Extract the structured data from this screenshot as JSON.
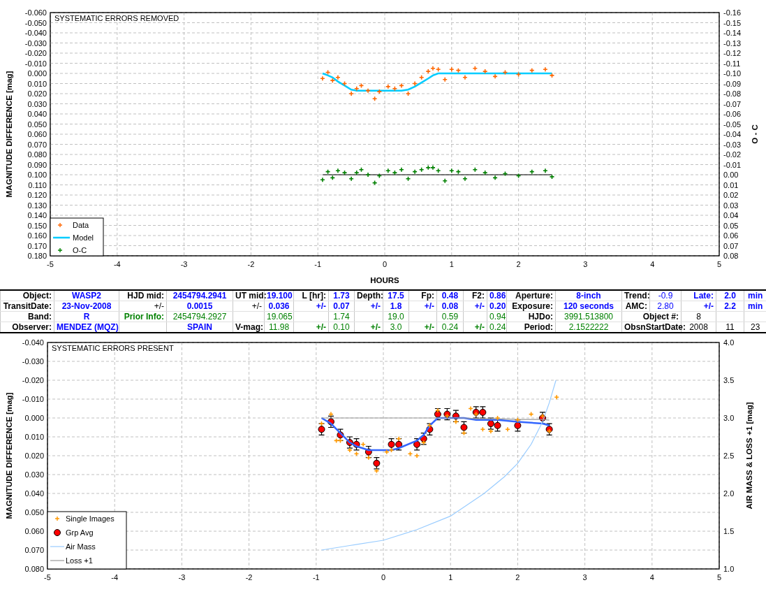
{
  "top_chart": {
    "chart_data": {
      "type": "scatter",
      "title": "SYSTEMATIC ERRORS REMOVED",
      "xlabel": "HOURS",
      "ylabel": "MAGNITUDE DIFFERENCE [mag]",
      "y2label": "O - C",
      "grid": true,
      "legend": "lower left",
      "xlim": [
        -5,
        5
      ],
      "ylim": [
        0.18,
        -0.06
      ],
      "y2lim": [
        0.08,
        -0.16
      ],
      "xticks": [
        {
          "value": -5,
          "label": "-5"
        },
        {
          "value": -4,
          "label": "-4"
        },
        {
          "value": -3,
          "label": "-3"
        },
        {
          "value": -2,
          "label": "-2"
        },
        {
          "value": -1,
          "label": "-1"
        },
        {
          "value": 0,
          "label": "0"
        },
        {
          "value": 1,
          "label": "1"
        },
        {
          "value": 2,
          "label": "2"
        },
        {
          "value": 3,
          "label": "3"
        },
        {
          "value": 4,
          "label": "4"
        },
        {
          "value": 5,
          "label": "5"
        }
      ],
      "yticks": [
        {
          "value": -0.06,
          "label": "-0.060"
        },
        {
          "value": -0.05,
          "label": "-0.050"
        },
        {
          "value": -0.04,
          "label": "-0.040"
        },
        {
          "value": -0.03,
          "label": "-0.030"
        },
        {
          "value": -0.02,
          "label": "-0.020"
        },
        {
          "value": -0.01,
          "label": "-0.010"
        },
        {
          "value": 0,
          "label": "0.000"
        },
        {
          "value": 0.01,
          "label": "0.010"
        },
        {
          "value": 0.02,
          "label": "0.020"
        },
        {
          "value": 0.03,
          "label": "0.030"
        },
        {
          "value": 0.04,
          "label": "0.040"
        },
        {
          "value": 0.05,
          "label": "0.050"
        },
        {
          "value": 0.06,
          "label": "0.060"
        },
        {
          "value": 0.07,
          "label": "0.070"
        },
        {
          "value": 0.08,
          "label": "0.080"
        },
        {
          "value": 0.09,
          "label": "0.090"
        },
        {
          "value": 0.1,
          "label": "0.100"
        },
        {
          "value": 0.11,
          "label": "0.110"
        },
        {
          "value": 0.12,
          "label": "0.120"
        },
        {
          "value": 0.13,
          "label": "0.130"
        },
        {
          "value": 0.14,
          "label": "0.140"
        },
        {
          "value": 0.15,
          "label": "0.150"
        },
        {
          "value": 0.16,
          "label": "0.160"
        },
        {
          "value": 0.17,
          "label": "0.170"
        },
        {
          "value": 0.18,
          "label": "0.180"
        }
      ],
      "y2ticks": [
        {
          "value": -0.16,
          "label": "-0.16"
        },
        {
          "value": -0.15,
          "label": "-0.15"
        },
        {
          "value": -0.14,
          "label": "-0.14"
        },
        {
          "value": -0.13,
          "label": "-0.13"
        },
        {
          "value": -0.12,
          "label": "-0.12"
        },
        {
          "value": -0.11,
          "label": "-0.11"
        },
        {
          "value": -0.1,
          "label": "-0.10"
        },
        {
          "value": -0.09,
          "label": "-0.09"
        },
        {
          "value": -0.08,
          "label": "-0.08"
        },
        {
          "value": -0.07,
          "label": "-0.07"
        },
        {
          "value": -0.06,
          "label": "-0.06"
        },
        {
          "value": -0.05,
          "label": "-0.05"
        },
        {
          "value": -0.04,
          "label": "-0.04"
        },
        {
          "value": -0.03,
          "label": "-0.03"
        },
        {
          "value": -0.02,
          "label": "-0.02"
        },
        {
          "value": -0.01,
          "label": "-0.01"
        },
        {
          "value": 0,
          "label": "0.00"
        },
        {
          "value": 0.01,
          "label": "0.01"
        },
        {
          "value": 0.02,
          "label": "0.02"
        },
        {
          "value": 0.03,
          "label": "0.03"
        },
        {
          "value": 0.04,
          "label": "0.04"
        },
        {
          "value": 0.05,
          "label": "0.05"
        },
        {
          "value": 0.06,
          "label": "0.06"
        },
        {
          "value": 0.07,
          "label": "0.07"
        },
        {
          "value": 0.08,
          "label": "0.08"
        }
      ],
      "x": [
        -0.93,
        -0.85,
        -0.78,
        -0.7,
        -0.6,
        -0.5,
        -0.42,
        -0.35,
        -0.25,
        -0.15,
        -0.08,
        0.05,
        0.15,
        0.25,
        0.35,
        0.45,
        0.55,
        0.65,
        0.72,
        0.8,
        0.9,
        1.0,
        1.1,
        1.2,
        1.35,
        1.5,
        1.65,
        1.8,
        2.0,
        2.2,
        2.4,
        2.5
      ],
      "series": [
        {
          "name": "Data",
          "type": "scatter",
          "marker": "plus",
          "color": "#ff6600",
          "values": [
            0.005,
            -0.001,
            0.007,
            0.004,
            0.01,
            0.02,
            0.015,
            0.012,
            0.017,
            0.025,
            0.018,
            0.013,
            0.015,
            0.012,
            0.02,
            0.01,
            0.004,
            -0.002,
            -0.005,
            -0.004,
            0.006,
            -0.004,
            -0.003,
            0.004,
            -0.005,
            -0.002,
            0.003,
            -0.001,
            0.001,
            -0.003,
            -0.004,
            0.002
          ]
        },
        {
          "name": "Model",
          "type": "line",
          "color": "#00ccff",
          "values": [
            0,
            0.002,
            0.004,
            0.008,
            0.012,
            0.016,
            0.017,
            0.017,
            0.017,
            0.017,
            0.017,
            0.017,
            0.017,
            0.017,
            0.016,
            0.013,
            0.009,
            0.005,
            0.002,
            0,
            0,
            0,
            0,
            0,
            0,
            0,
            0,
            0,
            0,
            0,
            0,
            0
          ]
        },
        {
          "name": "O-C",
          "type": "scatter",
          "marker": "plus",
          "color": "#008000",
          "axis": "y2",
          "values": [
            0.005,
            -0.003,
            0.003,
            -0.004,
            -0.002,
            0.004,
            -0.002,
            -0.005,
            0,
            0.008,
            0.001,
            -0.004,
            -0.002,
            -0.005,
            0.004,
            -0.003,
            -0.005,
            -0.007,
            -0.007,
            -0.004,
            0.006,
            -0.004,
            -0.003,
            0.004,
            -0.005,
            -0.002,
            0.003,
            -0.001,
            0.001,
            -0.003,
            -0.004,
            0.002
          ]
        },
        {
          "type": "line",
          "color": "#000000",
          "axis": "y2",
          "values": [
            0,
            0,
            0,
            0,
            0,
            0,
            0,
            0,
            0,
            0,
            0,
            0,
            0,
            0,
            0,
            0,
            0,
            0,
            0,
            0,
            0,
            0,
            0,
            0,
            0,
            0,
            0,
            0,
            0,
            0,
            0,
            0
          ]
        }
      ]
    }
  },
  "parameters_table": {
    "rows": [
      [
        {
          "text": "Object:",
          "kind": "label"
        },
        {
          "text": "WASP2",
          "kind": "blue"
        },
        {
          "text": "HJD mid:",
          "kind": "label"
        },
        {
          "text": "2454794.2941",
          "kind": "blue"
        },
        {
          "text": "UT mid:",
          "kind": "label"
        },
        {
          "text": "19.100",
          "kind": "blue"
        },
        {
          "text": "L [hr]:",
          "kind": "label"
        },
        {
          "text": "1.73",
          "kind": "blue"
        },
        {
          "text": "Depth:",
          "kind": "label"
        },
        {
          "text": "17.5",
          "kind": "blue"
        },
        {
          "text": "Fp:",
          "kind": "label"
        },
        {
          "text": "0.48",
          "kind": "blue"
        },
        {
          "text": "F2:",
          "kind": "label"
        },
        {
          "text": "0.86",
          "kind": "blue"
        },
        {
          "text": "Aperture:",
          "kind": "label"
        },
        {
          "text": "8-inch",
          "kind": "blue"
        },
        {
          "text": "Trend:",
          "kind": "label"
        },
        {
          "text": "-0.9",
          "kind": "blueplain"
        },
        {
          "text": "Late:",
          "kind": "bluelabel"
        },
        {
          "text": "2.0",
          "kind": "blue"
        },
        {
          "text": "min",
          "kind": "blue"
        }
      ],
      [
        {
          "text": "TransitDate:",
          "kind": "label"
        },
        {
          "text": "23-Nov-2008",
          "kind": "blue"
        },
        {
          "text": "+/-",
          "kind": "plainlabel"
        },
        {
          "text": "0.0015",
          "kind": "blue"
        },
        {
          "text": "+/-",
          "kind": "plainlabel"
        },
        {
          "text": "0.036",
          "kind": "blue"
        },
        {
          "text": "+/-",
          "kind": "bluelabel"
        },
        {
          "text": "0.07",
          "kind": "blue"
        },
        {
          "text": "+/-",
          "kind": "bluelabel"
        },
        {
          "text": "1.8",
          "kind": "blue"
        },
        {
          "text": "+/-",
          "kind": "bluelabel"
        },
        {
          "text": "0.08",
          "kind": "blue"
        },
        {
          "text": "+/-",
          "kind": "bluelabel"
        },
        {
          "text": "0.20",
          "kind": "blue"
        },
        {
          "text": "Exposure:",
          "kind": "label"
        },
        {
          "text": "120 seconds",
          "kind": "blue"
        },
        {
          "text": "AMC:",
          "kind": "label"
        },
        {
          "text": "2.80",
          "kind": "blueplain"
        },
        {
          "text": "+/-",
          "kind": "bluelabel"
        },
        {
          "text": "2.2",
          "kind": "blue"
        },
        {
          "text": "min",
          "kind": "blue"
        }
      ],
      [
        {
          "text": "Band:",
          "kind": "label"
        },
        {
          "text": "R",
          "kind": "blue"
        },
        {
          "text": "Prior Info:",
          "kind": "greenlabel"
        },
        {
          "text": "2454794.2927",
          "kind": "green"
        },
        null,
        {
          "text": "19.065",
          "kind": "green"
        },
        null,
        {
          "text": "1.74",
          "kind": "green"
        },
        null,
        {
          "text": "19.0",
          "kind": "green"
        },
        null,
        {
          "text": "0.59",
          "kind": "green"
        },
        null,
        {
          "text": "0.94",
          "kind": "green"
        },
        {
          "text": "HJDo:",
          "kind": "label"
        },
        {
          "text": "3991.513800",
          "kind": "green"
        },
        {
          "text": "Object #:",
          "kind": "label",
          "colspan": 2
        },
        {
          "text": "8",
          "kind": "plain"
        },
        null,
        null
      ],
      [
        {
          "text": "Observer:",
          "kind": "label"
        },
        {
          "text": "MENDEZ (MQZ)",
          "kind": "blue"
        },
        null,
        {
          "text": "SPAIN",
          "kind": "blue"
        },
        {
          "text": "V-mag:",
          "kind": "label"
        },
        {
          "text": "11.98",
          "kind": "green"
        },
        {
          "text": "+/-",
          "kind": "greenlabel"
        },
        {
          "text": "0.10",
          "kind": "green"
        },
        {
          "text": "+/-",
          "kind": "greenlabel"
        },
        {
          "text": "3.0",
          "kind": "green"
        },
        {
          "text": "+/-",
          "kind": "greenlabel"
        },
        {
          "text": "0.24",
          "kind": "green"
        },
        {
          "text": "+/-",
          "kind": "greenlabel"
        },
        {
          "text": "0.24",
          "kind": "green"
        },
        {
          "text": "Period:",
          "kind": "label"
        },
        {
          "text": "2.1522222",
          "kind": "green"
        },
        {
          "text": "ObsnStartDate:",
          "kind": "label",
          "colspan": 2
        },
        {
          "text": "2008",
          "kind": "plain"
        },
        {
          "text": "11",
          "kind": "plain"
        },
        {
          "text": "23",
          "kind": "plain"
        }
      ]
    ]
  },
  "bottom_chart": {
    "chart_data": {
      "type": "scatter",
      "title": "SYSTEMATIC ERRORS PRESENT",
      "ylabel": "MAGNITUDE DIFFERENCE [mag]",
      "y2label": "AIR MASS & LOSS +1 [mag]",
      "grid": true,
      "legend": "lower left",
      "xlim": [
        -5,
        5
      ],
      "ylim": [
        0.08,
        -0.04
      ],
      "y2lim": [
        1,
        4
      ],
      "xticks": [
        {
          "value": -5,
          "label": "-5"
        },
        {
          "value": -4,
          "label": "-4"
        },
        {
          "value": -3,
          "label": "-3"
        },
        {
          "value": -2,
          "label": "-2"
        },
        {
          "value": -1,
          "label": "-1"
        },
        {
          "value": 0,
          "label": "0"
        },
        {
          "value": 1,
          "label": "1"
        },
        {
          "value": 2,
          "label": "2"
        },
        {
          "value": 3,
          "label": "3"
        },
        {
          "value": 4,
          "label": "4"
        },
        {
          "value": 5,
          "label": "5"
        }
      ],
      "yticks": [
        {
          "value": -0.04,
          "label": "-0.040"
        },
        {
          "value": -0.03,
          "label": "-0.030"
        },
        {
          "value": -0.02,
          "label": "-0.020"
        },
        {
          "value": -0.01,
          "label": "-0.010"
        },
        {
          "value": 0,
          "label": "0.000"
        },
        {
          "value": 0.01,
          "label": "0.010"
        },
        {
          "value": 0.02,
          "label": "0.020"
        },
        {
          "value": 0.03,
          "label": "0.030"
        },
        {
          "value": 0.04,
          "label": "0.040"
        },
        {
          "value": 0.05,
          "label": "0.050"
        },
        {
          "value": 0.06,
          "label": "0.060"
        },
        {
          "value": 0.07,
          "label": "0.070"
        },
        {
          "value": 0.08,
          "label": "0.080"
        }
      ],
      "y2ticks": [
        {
          "value": 1,
          "label": "1.0"
        },
        {
          "value": 1.5,
          "label": "1.5"
        },
        {
          "value": 2,
          "label": "2.0"
        },
        {
          "value": 2.5,
          "label": "2.5"
        },
        {
          "value": 3,
          "label": "3.0"
        },
        {
          "value": 3.5,
          "label": "3.5"
        },
        {
          "value": 4,
          "label": "4.0"
        }
      ],
      "x": [
        -0.92,
        -0.78,
        -0.64,
        -0.5,
        -0.4,
        -0.22,
        -0.1,
        0.12,
        0.23,
        0.5,
        0.6,
        0.69,
        0.81,
        0.95,
        1.08,
        1.2,
        1.38,
        1.48,
        1.6,
        1.7,
        2.0,
        2.37,
        2.47
      ],
      "series": [
        {
          "name": "Single Images",
          "type": "scatter",
          "marker": "plus",
          "color": "#ff9900",
          "x": [
            -0.92,
            -0.78,
            -0.7,
            -0.64,
            -0.5,
            -0.4,
            -0.3,
            -0.22,
            -0.1,
            0.05,
            0.12,
            0.23,
            0.4,
            0.5,
            0.6,
            0.69,
            0.81,
            0.95,
            1.08,
            1.2,
            1.3,
            1.38,
            1.48,
            1.6,
            1.7,
            1.85,
            2.0,
            2.2,
            2.37,
            2.47,
            2.58
          ],
          "values": [
            0.003,
            -0.002,
            0.012,
            0.012,
            0.017,
            0.019,
            0.014,
            0.021,
            0.028,
            0.018,
            0.017,
            0.011,
            0.019,
            0.02,
            0.013,
            0.004,
            -0.004,
            -0.001,
            0.002,
            0.008,
            -0.005,
            -0.002,
            0.006,
            0.007,
            0.0,
            0.006,
            0.001,
            -0.002,
            -0.001,
            0.007,
            -0.011
          ]
        },
        {
          "name": "Grp Avg",
          "type": "scatter",
          "marker": "circle",
          "color": "#ff0000",
          "errors": [
            0.003,
            0.003,
            0.003,
            0.003,
            0.003,
            0.003,
            0.003,
            0.003,
            0.003,
            0.003,
            0.003,
            0.003,
            0.003,
            0.003,
            0.003,
            0.003,
            0.003,
            0.003,
            0.003,
            0.003,
            0.003,
            0.003,
            0.003
          ],
          "values": [
            0.006,
            0.002,
            0.009,
            0.013,
            0.014,
            0.018,
            0.024,
            0.014,
            0.014,
            0.014,
            0.011,
            0.006,
            -0.002,
            -0.002,
            -0.001,
            0.005,
            -0.003,
            -0.003,
            0.003,
            0.004,
            0.004,
            0,
            0.006
          ]
        },
        {
          "type": "line",
          "color": "#3366ff",
          "values": [
            0,
            0.003,
            0.008,
            0.013,
            0.015,
            0.017,
            0.017,
            0.017,
            0.016,
            0.012,
            0.009,
            0.004,
            0,
            0,
            0,
            0,
            0.001,
            0.001,
            0.001,
            0.001,
            0.002,
            0.003,
            0.004
          ]
        },
        {
          "name": "Air Mass",
          "type": "line",
          "color": "#99ccff",
          "axis": "y2",
          "x": [
            -0.92,
            -0.5,
            0,
            0.5,
            1.0,
            1.5,
            1.8,
            2.0,
            2.2,
            2.37,
            2.47,
            2.57
          ],
          "values": [
            1.25,
            1.31,
            1.38,
            1.52,
            1.7,
            2.0,
            2.22,
            2.4,
            2.65,
            2.95,
            3.2,
            3.5
          ]
        },
        {
          "name": "Loss +1",
          "type": "line",
          "color": "#999999",
          "axis": "y2",
          "values": [
            3,
            3,
            3,
            3,
            3,
            3,
            3,
            3,
            3,
            3,
            3,
            3,
            3,
            3,
            3,
            3,
            2.99,
            2.99,
            2.99,
            2.99,
            2.98,
            2.98,
            2.97
          ]
        }
      ]
    }
  }
}
